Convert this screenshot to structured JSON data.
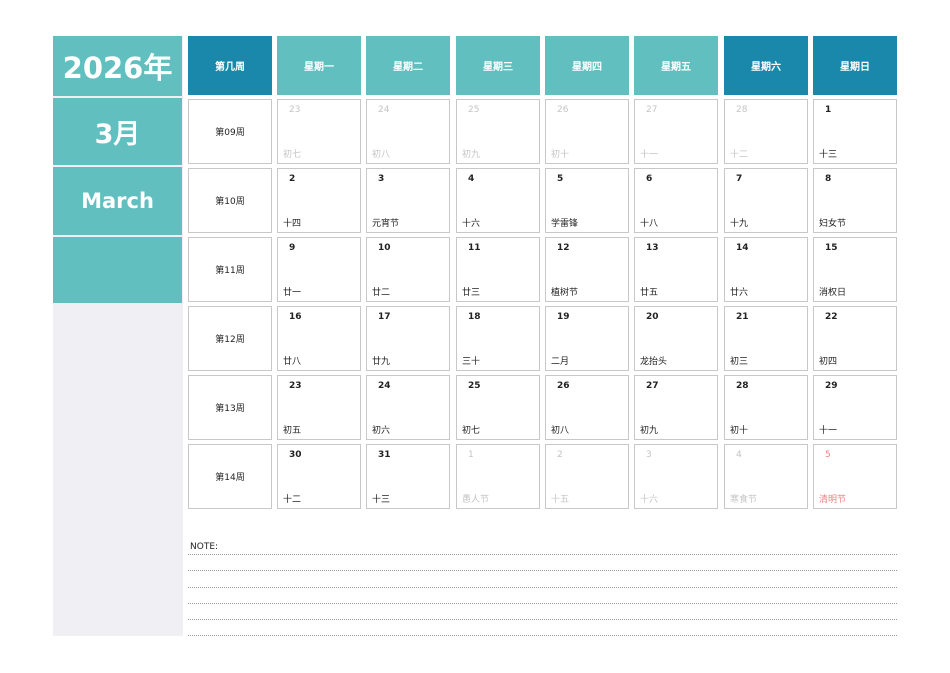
{
  "sidebar": {
    "year": "2026年",
    "month_cn": "3月",
    "month_en": "March"
  },
  "header": {
    "week_col": "第几周",
    "days": [
      "星期一",
      "星期二",
      "星期三",
      "星期四",
      "星期五",
      "星期六",
      "星期日"
    ]
  },
  "weeks": [
    {
      "label": "第09周",
      "days": [
        {
          "num": "23",
          "lunar": "初七",
          "muted": true
        },
        {
          "num": "24",
          "lunar": "初八",
          "muted": true
        },
        {
          "num": "25",
          "lunar": "初九",
          "muted": true
        },
        {
          "num": "26",
          "lunar": "初十",
          "muted": true
        },
        {
          "num": "27",
          "lunar": "十一",
          "muted": true
        },
        {
          "num": "28",
          "lunar": "十二",
          "muted": true
        },
        {
          "num": "1",
          "lunar": "十三"
        }
      ]
    },
    {
      "label": "第10周",
      "days": [
        {
          "num": "2",
          "lunar": "十四"
        },
        {
          "num": "3",
          "lunar": "元宵节"
        },
        {
          "num": "4",
          "lunar": "十六"
        },
        {
          "num": "5",
          "lunar": "学雷锋"
        },
        {
          "num": "6",
          "lunar": "十八"
        },
        {
          "num": "7",
          "lunar": "十九"
        },
        {
          "num": "8",
          "lunar": "妇女节"
        }
      ]
    },
    {
      "label": "第11周",
      "days": [
        {
          "num": "9",
          "lunar": "廿一"
        },
        {
          "num": "10",
          "lunar": "廿二"
        },
        {
          "num": "11",
          "lunar": "廿三"
        },
        {
          "num": "12",
          "lunar": "植树节"
        },
        {
          "num": "13",
          "lunar": "廿五"
        },
        {
          "num": "14",
          "lunar": "廿六"
        },
        {
          "num": "15",
          "lunar": "消权日"
        }
      ]
    },
    {
      "label": "第12周",
      "days": [
        {
          "num": "16",
          "lunar": "廿八"
        },
        {
          "num": "17",
          "lunar": "廿九"
        },
        {
          "num": "18",
          "lunar": "三十"
        },
        {
          "num": "19",
          "lunar": "二月"
        },
        {
          "num": "20",
          "lunar": "龙抬头"
        },
        {
          "num": "21",
          "lunar": "初三"
        },
        {
          "num": "22",
          "lunar": "初四"
        }
      ]
    },
    {
      "label": "第13周",
      "days": [
        {
          "num": "23",
          "lunar": "初五"
        },
        {
          "num": "24",
          "lunar": "初六"
        },
        {
          "num": "25",
          "lunar": "初七"
        },
        {
          "num": "26",
          "lunar": "初八"
        },
        {
          "num": "27",
          "lunar": "初九"
        },
        {
          "num": "28",
          "lunar": "初十"
        },
        {
          "num": "29",
          "lunar": "十一"
        }
      ]
    },
    {
      "label": "第14周",
      "days": [
        {
          "num": "30",
          "lunar": "十二"
        },
        {
          "num": "31",
          "lunar": "十三"
        },
        {
          "num": "1",
          "lunar": "愚人节",
          "muted": true
        },
        {
          "num": "2",
          "lunar": "十五",
          "muted": true
        },
        {
          "num": "3",
          "lunar": "十六",
          "muted": true
        },
        {
          "num": "4",
          "lunar": "寒食节",
          "muted": true
        },
        {
          "num": "5",
          "lunar": "清明节",
          "muted_red": true
        }
      ]
    }
  ],
  "note": {
    "label": "NOTE:"
  },
  "colors": {
    "teal": "#62bfc0",
    "dark_blue": "#1a88ab",
    "sidebar_bg": "#efeff4",
    "muted_text": "#c4c4c4",
    "holiday_red": "#f08080"
  }
}
